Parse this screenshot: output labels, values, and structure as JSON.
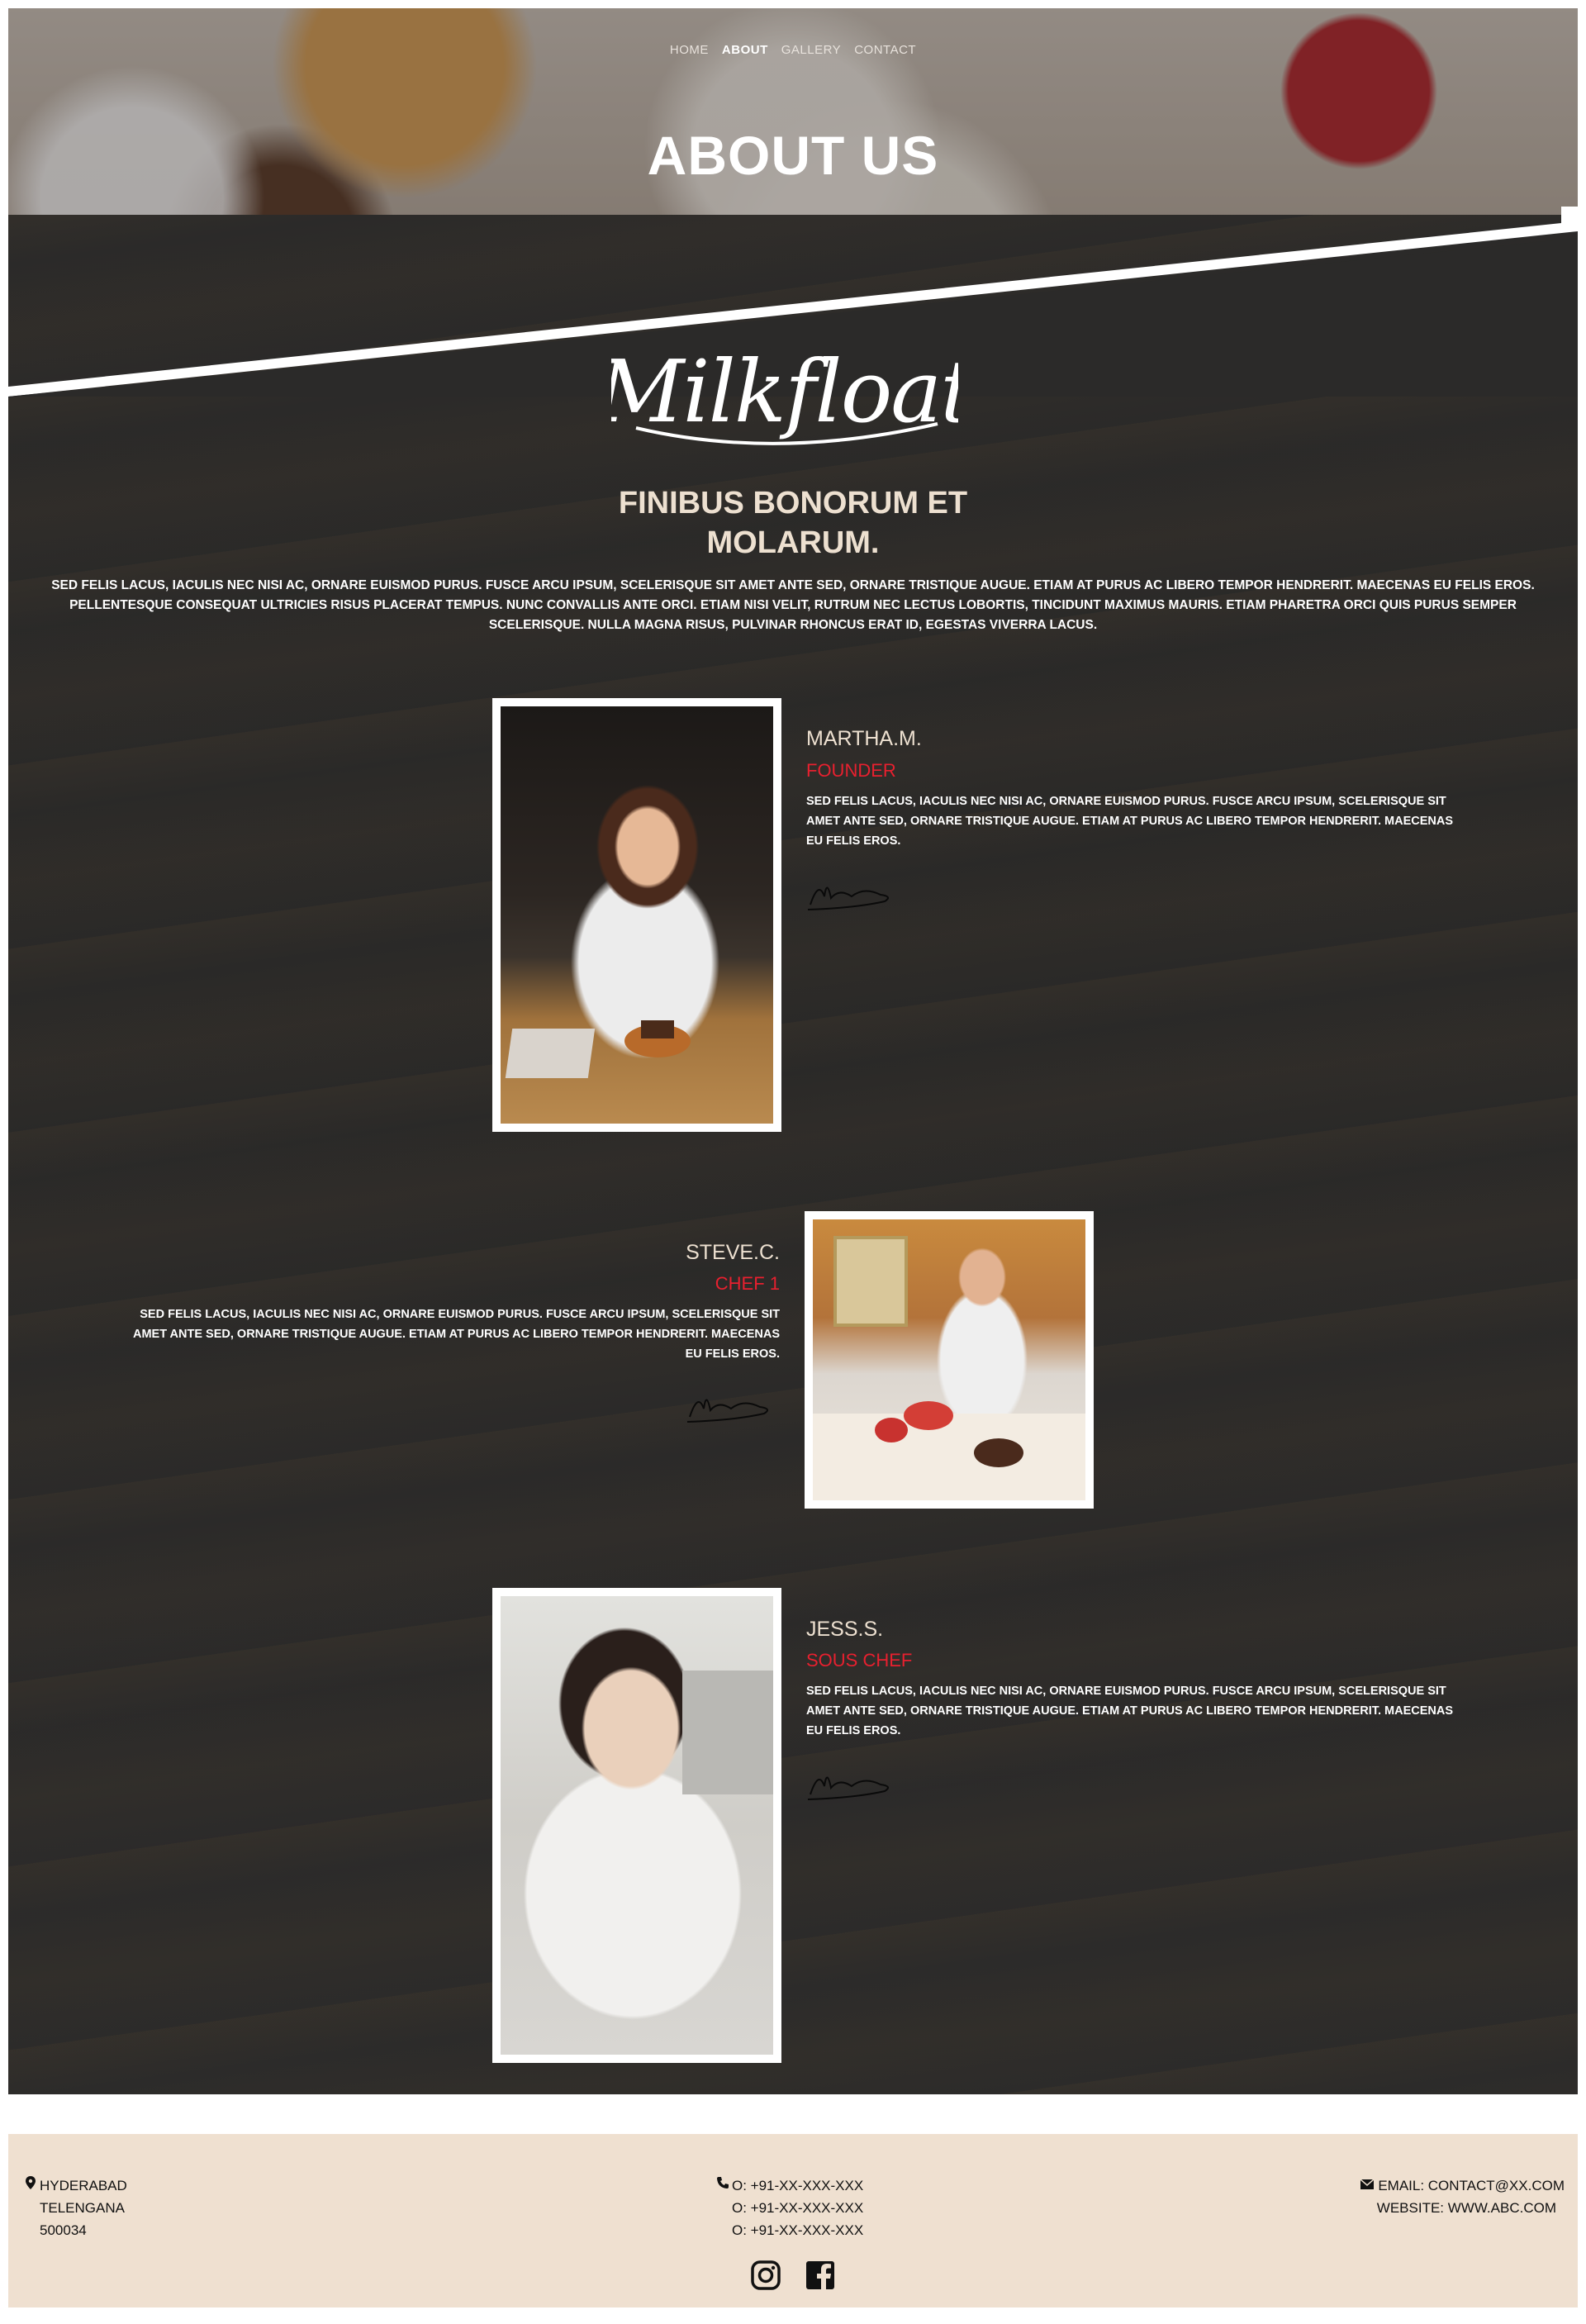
{
  "nav": {
    "items": [
      "HOME",
      "ABOUT",
      "GALLERY",
      "CONTACT"
    ],
    "active": "ABOUT"
  },
  "hero": {
    "title": "ABOUT US"
  },
  "logo": {
    "text": "Milkfloat"
  },
  "intro": {
    "heading_line1": "FINIBUS BONORUM ET",
    "heading_line2": "MOLARUM.",
    "text": "SED FELIS LACUS, IACULIS NEC NISI AC, ORNARE EUISMOD PURUS. FUSCE ARCU IPSUM, SCELERISQUE SIT AMET ANTE SED, ORNARE TRISTIQUE AUGUE. ETIAM AT PURUS AC LIBERO TEMPOR HENDRERIT. MAECENAS EU FELIS EROS. PELLENTESQUE CONSEQUAT ULTRICIES RISUS PLACERAT TEMPUS. NUNC CONVALLIS ANTE ORCI. ETIAM NISI VELIT, RUTRUM NEC LECTUS LOBORTIS, TINCIDUNT MAXIMUS MAURIS. ETIAM PHARETRA ORCI QUIS PURUS SEMPER SCELERISQUE. NULLA MAGNA RISUS, PULVINAR RHONCUS ERAT ID, EGESTAS VIVERRA LACUS."
  },
  "team": [
    {
      "name": "MARTHA.M.",
      "role": "FOUNDER",
      "bio": "SED FELIS LACUS, IACULIS NEC NISI AC, ORNARE EUISMOD PURUS. FUSCE ARCU IPSUM, SCELERISQUE SIT AMET ANTE SED, ORNARE TRISTIQUE AUGUE. ETIAM AT PURUS AC LIBERO TEMPOR HENDRERIT. MAECENAS EU FELIS EROS."
    },
    {
      "name": "STEVE.C.",
      "role": "CHEF 1",
      "bio": "SED FELIS LACUS, IACULIS NEC NISI AC, ORNARE EUISMOD PURUS. FUSCE ARCU IPSUM, SCELERISQUE SIT AMET ANTE SED, ORNARE TRISTIQUE AUGUE. ETIAM AT PURUS AC LIBERO TEMPOR HENDRERIT. MAECENAS EU FELIS EROS."
    },
    {
      "name": "JESS.S.",
      "role": "SOUS CHEF",
      "bio": "SED FELIS LACUS, IACULIS NEC NISI AC, ORNARE EUISMOD PURUS. FUSCE ARCU IPSUM, SCELERISQUE SIT AMET ANTE SED, ORNARE TRISTIQUE AUGUE. ETIAM AT PURUS AC LIBERO TEMPOR HENDRERIT. MAECENAS EU FELIS EROS."
    }
  ],
  "footer": {
    "address": [
      "HYDERABAD",
      "TELENGANA",
      "500034"
    ],
    "phones": [
      "O: +91-XX-XXX-XXX",
      "O: +91-XX-XXX-XXX",
      "O: +91-XX-XXX-XXX"
    ],
    "email": "EMAIL: CONTACT@XX.COM",
    "website": "WEBSITE: WWW.ABC.COM",
    "icons": {
      "address": "map-pin-icon",
      "phone": "phone-icon",
      "email": "envelope-icon"
    },
    "social": [
      "instagram-icon",
      "facebook-icon"
    ]
  },
  "colors": {
    "accent_red": "#e8202f",
    "heading_cream": "#ede0d0",
    "footer_bg": "#efe0d0",
    "dark_bg": "#2b2a29"
  }
}
